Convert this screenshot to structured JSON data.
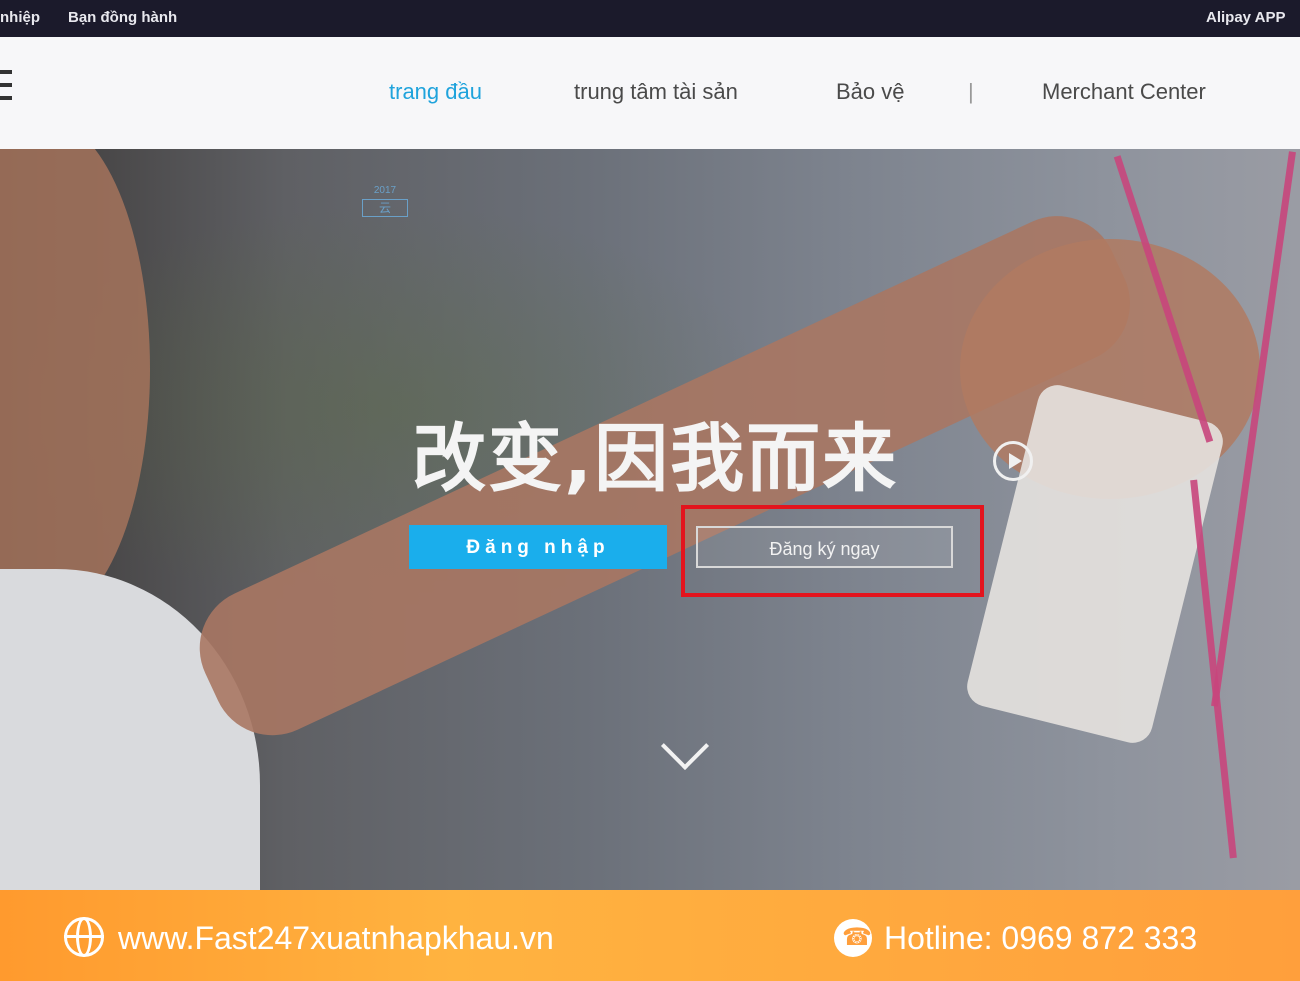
{
  "topbar": {
    "left_partial": "nhiệp",
    "partner": "Bạn đồng hành",
    "app": "Alipay APP"
  },
  "nav": {
    "items": [
      {
        "label": "trang đầu",
        "active": true
      },
      {
        "label": "trung tâm tài sản"
      },
      {
        "label": "Bảo vệ"
      },
      {
        "label": "|"
      },
      {
        "label": "Merchant Center"
      }
    ]
  },
  "hero": {
    "slogan": "改变,因我而来",
    "badge_top": "2017",
    "badge_box": "云",
    "login_label": "Đăng nhập",
    "register_label": "Đăng ký ngay"
  },
  "footer": {
    "website": "www.Fast247xuatnhapkhau.vn",
    "hotline": "Hotline: 0969 872 333"
  },
  "colors": {
    "accent": "#1aaeec",
    "highlight": "#e3141d",
    "footer": "#ff9f3c"
  }
}
